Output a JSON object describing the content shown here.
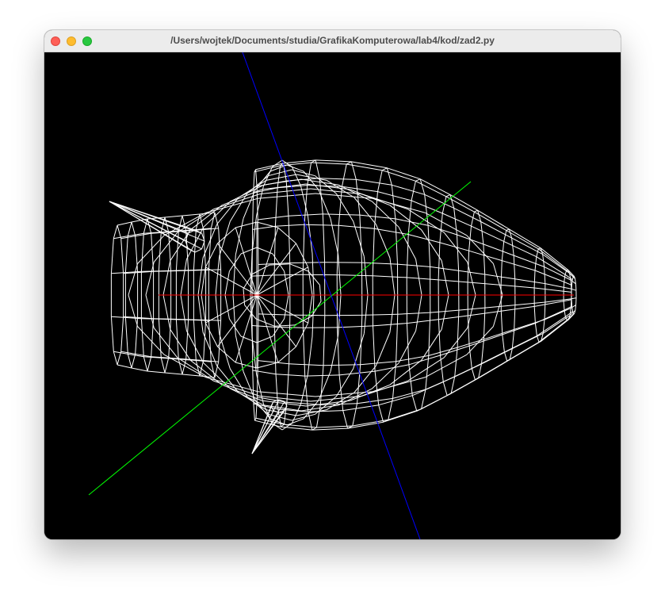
{
  "window": {
    "title": "/Users/wojtek/Documents/studia/GrafikaKomputerowa/lab4/kod/zad2.py",
    "background_color": "#000000"
  },
  "traffic_lights": {
    "close_color": "#fe5f57",
    "minimize_color": "#febc2e",
    "zoom_color": "#28c840"
  },
  "scene": {
    "render_mode": "wireframe",
    "mesh_color": "#ffffff",
    "axes": [
      {
        "axis": "x",
        "color": "#ff0000"
      },
      {
        "axis": "y",
        "color": "#00ff00"
      },
      {
        "axis": "z",
        "color": "#0000ff"
      }
    ]
  }
}
